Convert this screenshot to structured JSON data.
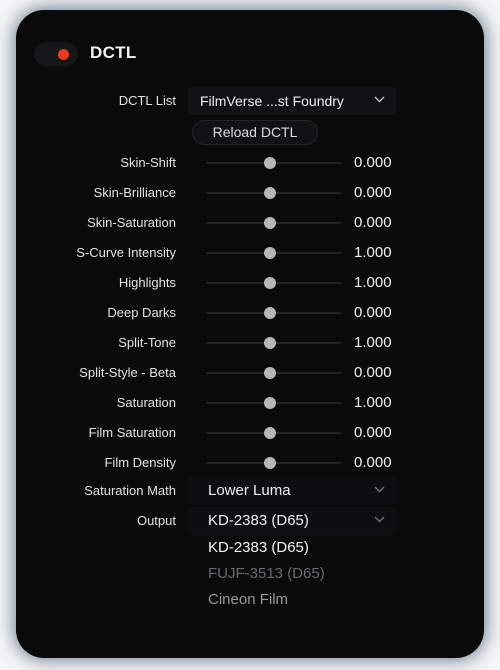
{
  "panel": {
    "title": "DCTL",
    "toggle_on": true,
    "accent_color": "#ec3a22",
    "background_color": "#0a0a0b"
  },
  "dctl_list": {
    "label": "DCTL List",
    "value": "FilmVerse ...st Foundry",
    "chevron": "chevron-down-icon"
  },
  "reload": {
    "label": "Reload DCTL"
  },
  "sliders": [
    {
      "label": "Skin-Shift",
      "value": "0.000"
    },
    {
      "label": "Skin-Brilliance",
      "value": "0.000"
    },
    {
      "label": "Skin-Saturation",
      "value": "0.000"
    },
    {
      "label": "S-Curve Intensity",
      "value": "1.000"
    },
    {
      "label": "Highlights",
      "value": "1.000"
    },
    {
      "label": "Deep Darks",
      "value": "0.000"
    },
    {
      "label": "Split-Tone",
      "value": "1.000"
    },
    {
      "label": "Split-Style - Beta",
      "value": "0.000"
    },
    {
      "label": "Saturation",
      "value": "1.000"
    },
    {
      "label": "Film Saturation",
      "value": "0.000"
    },
    {
      "label": "Film Density",
      "value": "0.000"
    }
  ],
  "saturation_math": {
    "label": "Saturation Math",
    "value": "Lower Luma"
  },
  "output": {
    "label": "Output",
    "value": "KD-2383 (D65)",
    "options": [
      {
        "label": "KD-2383 (D65)",
        "state": "sel"
      },
      {
        "label": "FUJF-3513 (D65)",
        "state": "dim"
      },
      {
        "label": "Cineon Film",
        "state": "mid"
      }
    ]
  }
}
